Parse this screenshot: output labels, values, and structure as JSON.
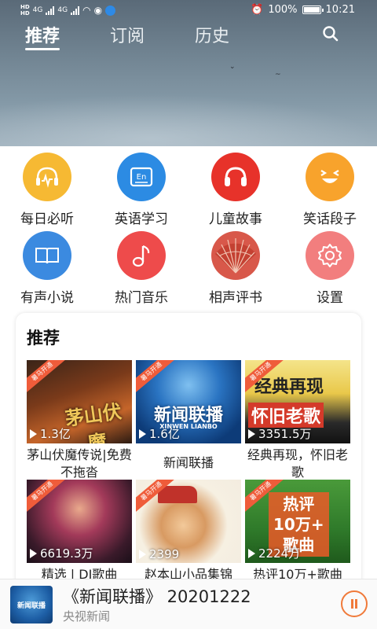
{
  "status": {
    "net1": "4G",
    "net2": "4G",
    "hd": "HD",
    "battery": "100%",
    "time": "10:21"
  },
  "tabs": [
    {
      "label": "推荐",
      "active": true
    },
    {
      "label": "订阅",
      "active": false
    },
    {
      "label": "历史",
      "active": false
    }
  ],
  "categories": [
    {
      "label": "每日必听",
      "icon": "headphone-wave-icon",
      "color": "#f6b933"
    },
    {
      "label": "英语学习",
      "icon": "english-icon",
      "color": "#2c8be3"
    },
    {
      "label": "儿童故事",
      "icon": "headphones-icon",
      "color": "#e7322a"
    },
    {
      "label": "笑话段子",
      "icon": "laughing-face-icon",
      "color": "#f8a32c"
    },
    {
      "label": "有声小说",
      "icon": "open-book-icon",
      "color": "#3b8ae0"
    },
    {
      "label": "热门音乐",
      "icon": "music-note-icon",
      "color": "#ee4b4b"
    },
    {
      "label": "相声评书",
      "icon": "folding-fan-icon",
      "color": "#d8584a"
    },
    {
      "label": "设置",
      "icon": "gear-icon",
      "color": "#f27e7e"
    }
  ],
  "recommend": {
    "title": "推荐",
    "ribbon": "暑马开通",
    "items": [
      {
        "name": "茅山伏魔传说|免费不拖沓",
        "plays": "1.3亿",
        "overlay": "茅山伏魔"
      },
      {
        "name": "新闻联播",
        "plays": "1.6亿",
        "overlay": "新闻联播",
        "overlay_sub": "XINWEN  LIANBO"
      },
      {
        "name": "经典再现，怀旧老歌",
        "plays": "3351.5万",
        "overlay": "怀旧老歌",
        "overlay_top": "经典再现"
      },
      {
        "name": "精选 | DJ歌曲",
        "plays": "6619.3万"
      },
      {
        "name": "赵本山小品集锦",
        "plays": "2399"
      },
      {
        "name": "热评10万+歌曲",
        "plays": "2224万",
        "overlay": "热评\n10万+\n歌曲"
      }
    ]
  },
  "player": {
    "title": "《新闻联播》 20201222",
    "subtitle": "央视新闻",
    "cover_text": "新闻联播"
  }
}
